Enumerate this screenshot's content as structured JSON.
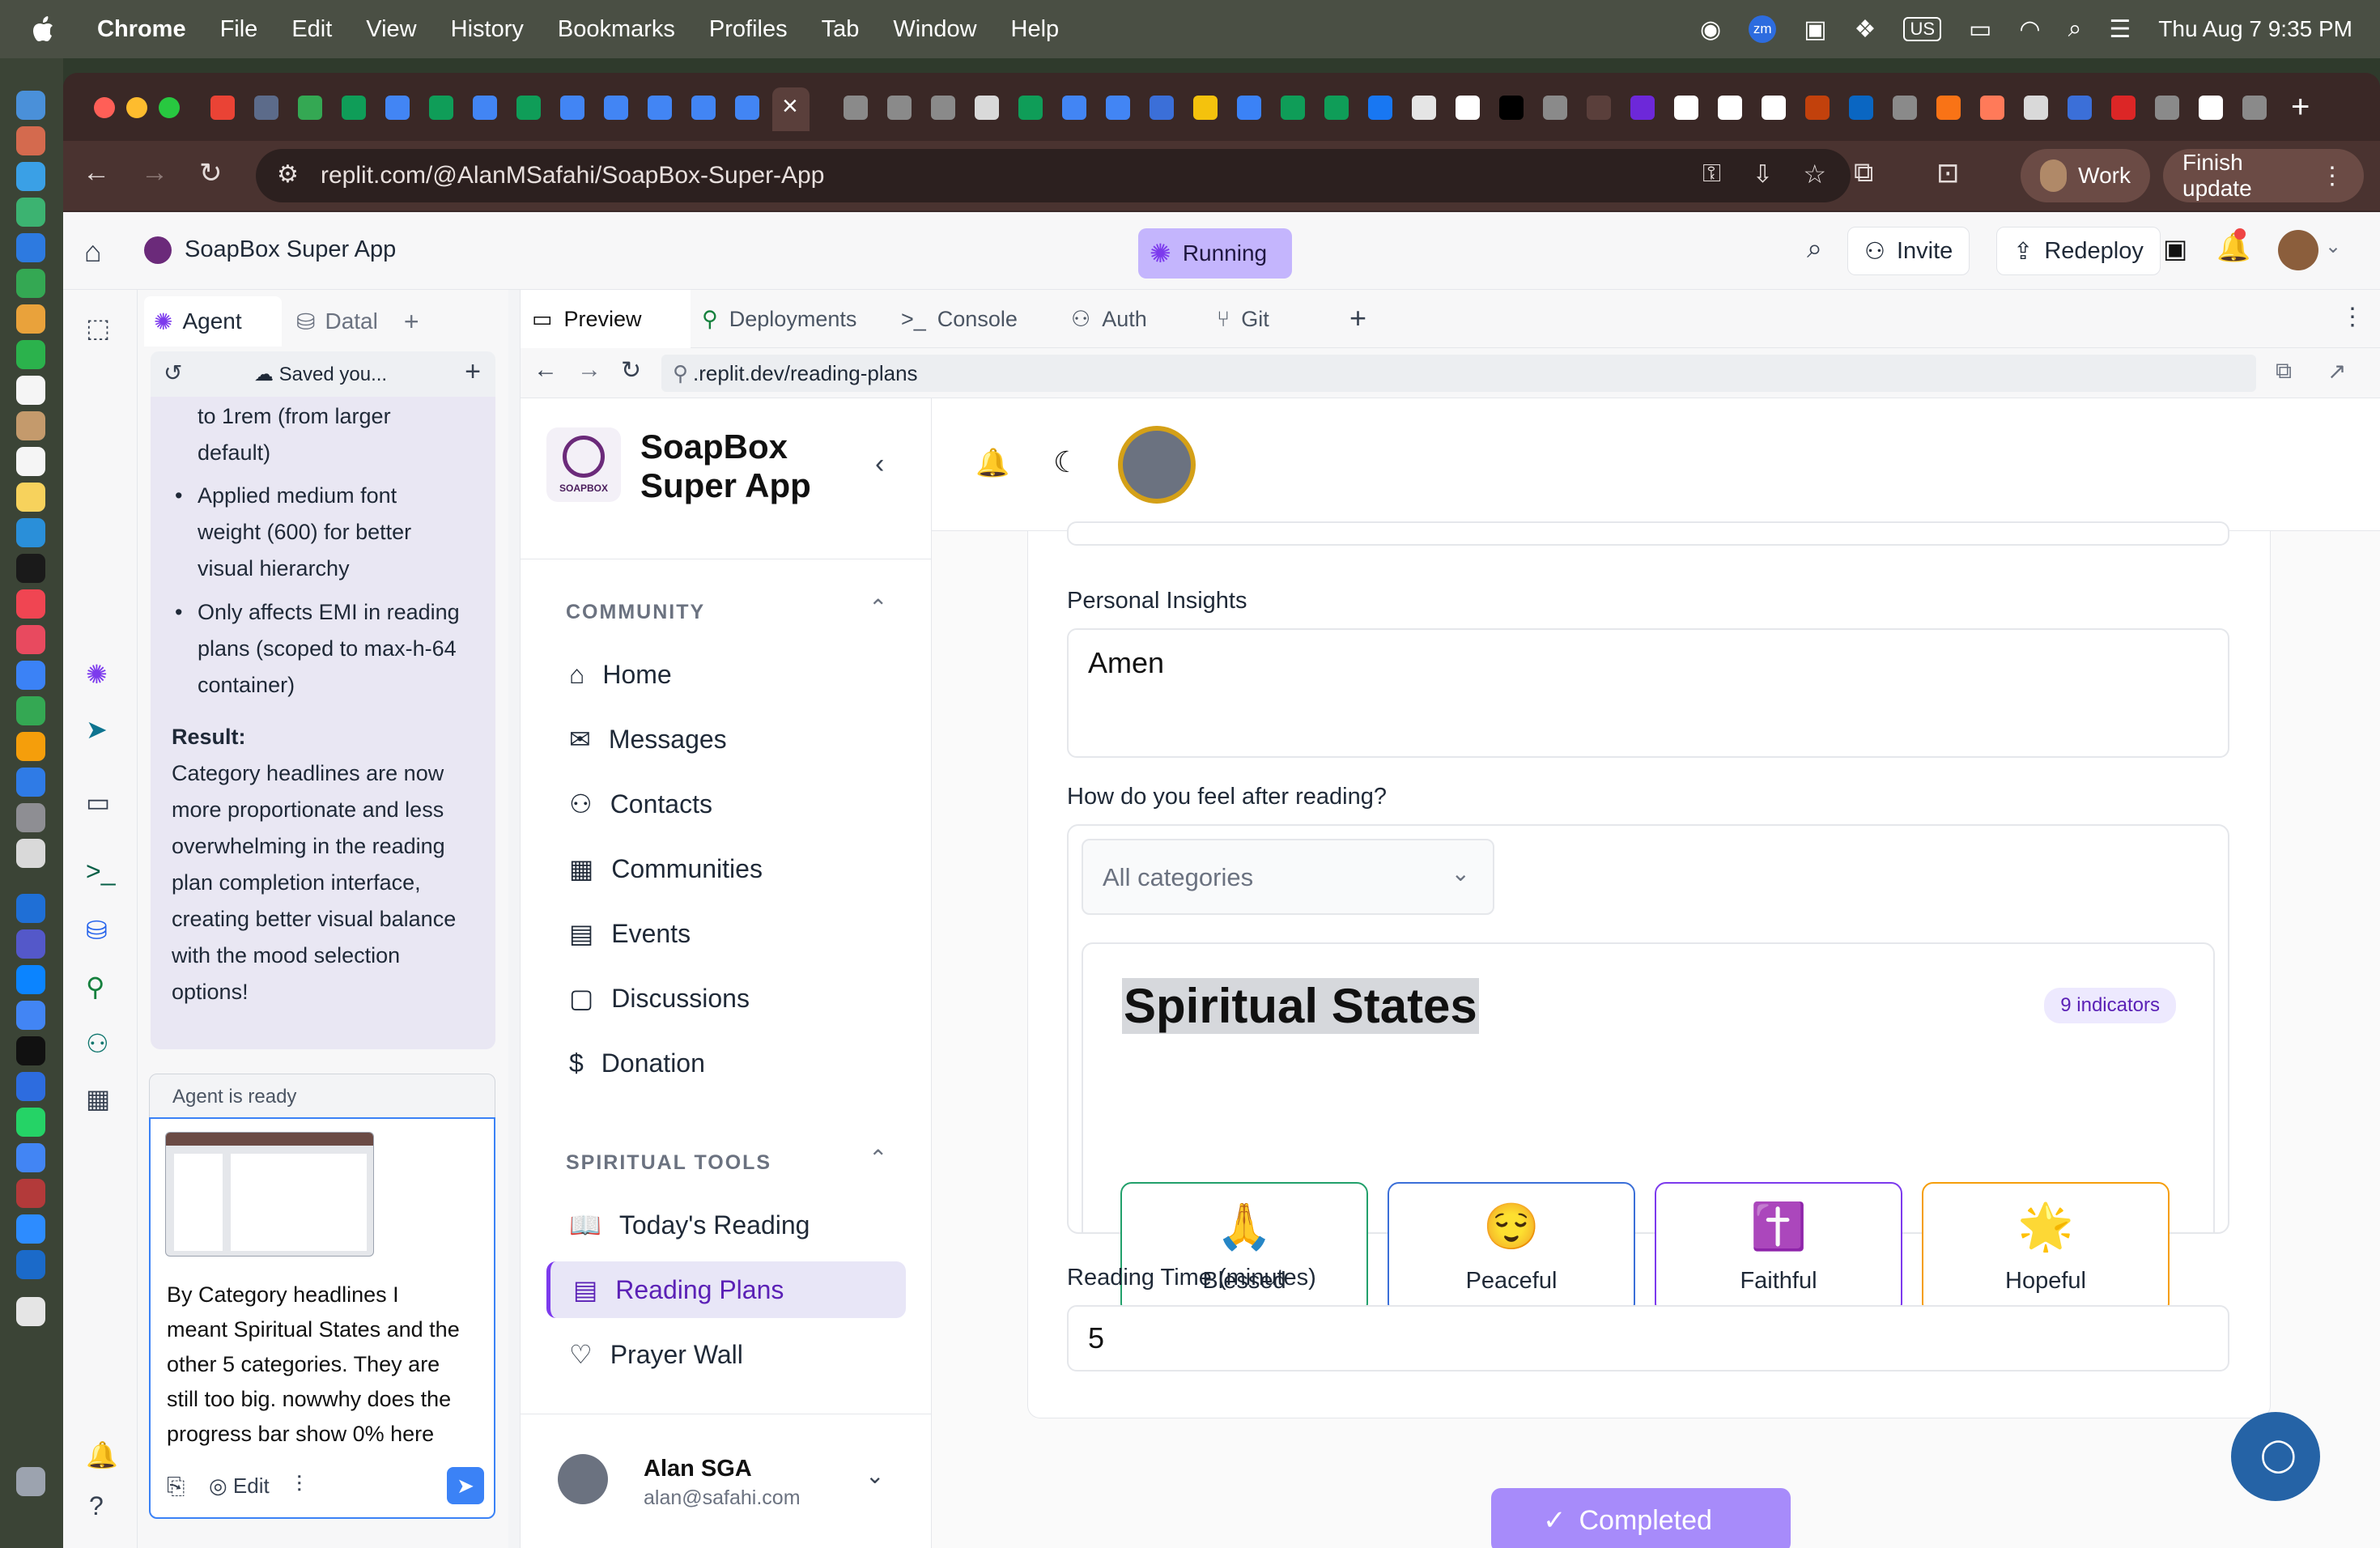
{
  "menubar": {
    "app": "Chrome",
    "items": [
      "File",
      "Edit",
      "View",
      "History",
      "Bookmarks",
      "Profiles",
      "Tab",
      "Window",
      "Help"
    ],
    "status": {
      "input_source": "US",
      "clock": "Thu Aug 7  9:35 PM",
      "zoom_badge": "zm"
    }
  },
  "browser": {
    "url": "replit.com/@AlanMSafahi/SoapBox-Super-App",
    "profile": "Work",
    "update_button": "Finish update"
  },
  "replit": {
    "project_name": "SoapBox Super App",
    "run_status": "Running",
    "invite_label": "Invite",
    "redeploy_label": "Redeploy",
    "agent_tabs": {
      "agent": "Agent",
      "database": "Datal"
    },
    "agent_header": "Saved you...",
    "agent_messages": {
      "line0": "to 1rem (from larger",
      "line1": "default)",
      "bullet1": [
        "Applied medium font",
        "weight (600) for better",
        "visual hierarchy"
      ],
      "bullet2": [
        "Only affects EMI in reading",
        "plans (scoped to max-h-64",
        "container)"
      ],
      "result_label": "Result:",
      "result_lines": [
        "Category headlines are now",
        "more proportionate and less",
        "overwhelming in the reading",
        "plan completion interface,",
        "creating better visual balance",
        "with the mood selection",
        "options!"
      ]
    },
    "chat": {
      "status": "Agent is ready",
      "draft_lines": [
        "By Category headlines I",
        "meant Spiritual States and the",
        "other 5 categories. They are",
        "still too big.  nowwhy does the",
        "progress bar show 0% here"
      ],
      "edit_label": "Edit"
    },
    "preview_tabs": [
      "Preview",
      "Deployments",
      "Console",
      "Auth",
      "Git"
    ],
    "preview_url": ".replit.dev/reading-plans"
  },
  "app": {
    "brand_line1": "SoapBox",
    "brand_line2": "Super App",
    "logo_text": "SOAPBOX",
    "sections": {
      "community": "COMMUNITY",
      "spiritual": "SPIRITUAL TOOLS"
    },
    "nav_community": [
      "Home",
      "Messages",
      "Contacts",
      "Communities",
      "Events",
      "Discussions",
      "Donation"
    ],
    "nav_spiritual": [
      "Today's Reading",
      "Reading Plans",
      "Prayer Wall"
    ],
    "user": {
      "name": "Alan SGA",
      "email": "alan@safahi.com"
    },
    "form": {
      "insights_label": "Personal Insights",
      "insights_value": "Amen",
      "feel_label": "How do you feel after reading?",
      "category_select": "All categories",
      "group_title": "Spiritual States",
      "group_badge": "9 indicators",
      "moods": [
        {
          "emoji": "🙏",
          "label": "Blessed",
          "color": "#22a06b"
        },
        {
          "emoji": "😌",
          "label": "Peaceful",
          "color": "#3b6fd8"
        },
        {
          "emoji": "✝️",
          "label": "Faithful",
          "color": "#7c3aed"
        },
        {
          "emoji": "🌟",
          "label": "Hopeful",
          "color": "#f59e0b"
        }
      ],
      "next_row_colors": [
        "#3b6fd8",
        "#3b6fd8",
        "#dc2626",
        "#3b6fd8"
      ],
      "reading_time_label": "Reading Time (minutes)",
      "reading_time_value": "5",
      "completed_label": "Completed"
    }
  }
}
